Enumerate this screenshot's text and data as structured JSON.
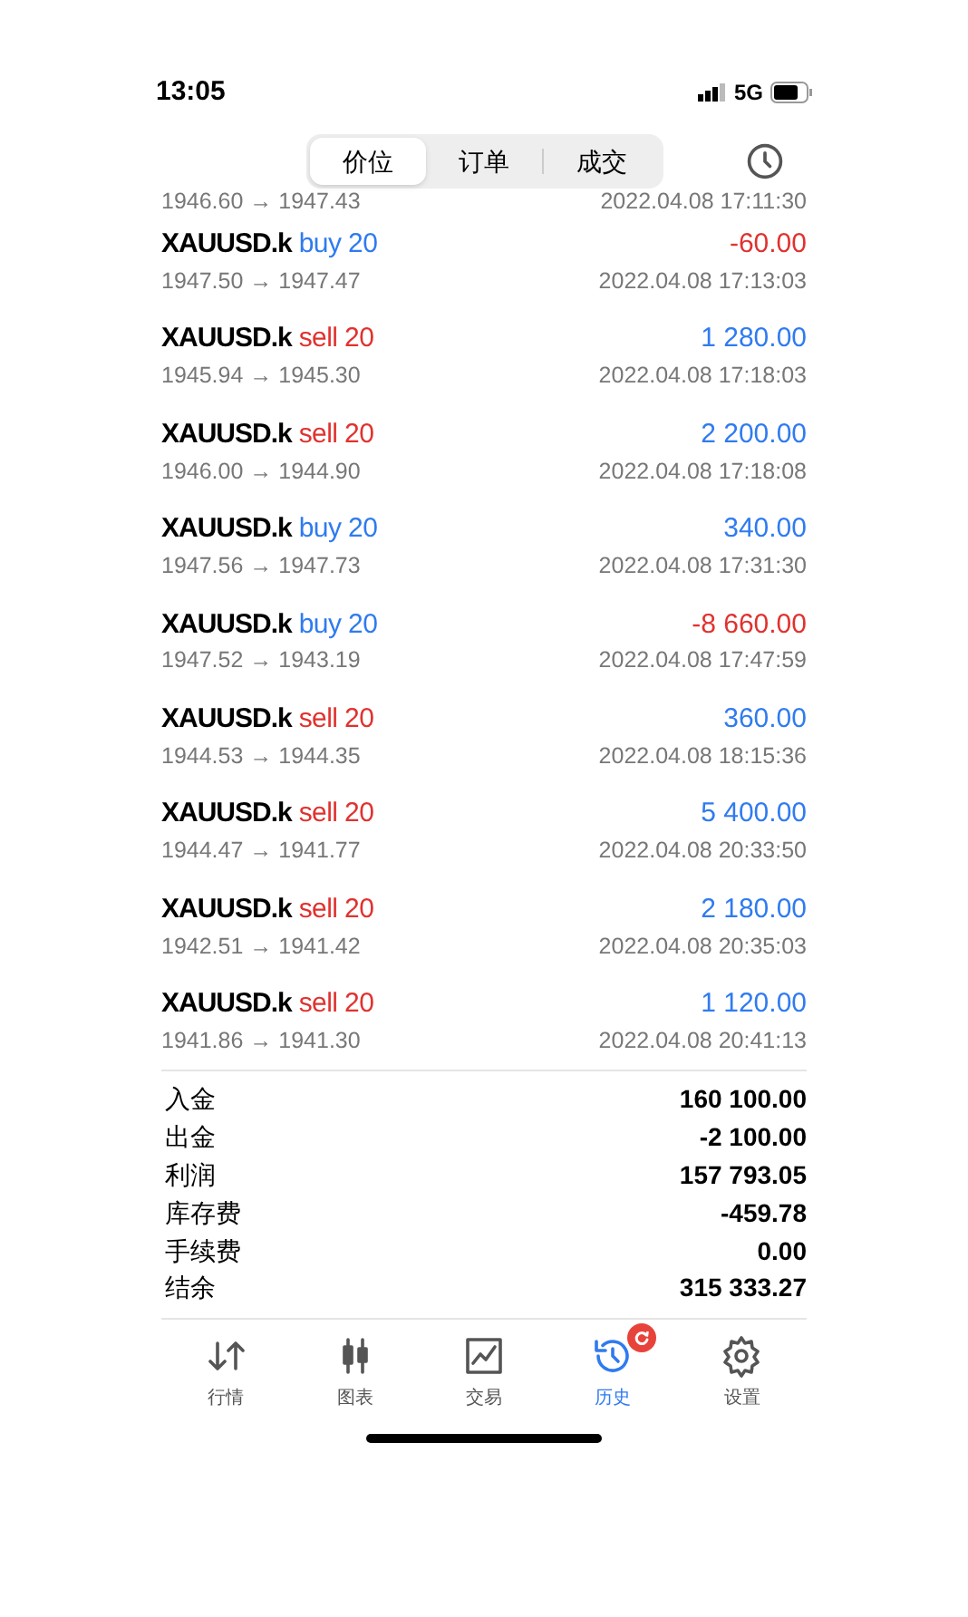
{
  "status_bar": {
    "time": "13:05",
    "network": "5G"
  },
  "tabs": [
    {
      "label": "价位",
      "selected": true
    },
    {
      "label": "订单",
      "selected": false
    },
    {
      "label": "成交",
      "selected": false
    }
  ],
  "partial_row": {
    "prices": "1946.60 → 1947.43",
    "time": "2022.04.08 17:11:30"
  },
  "deals": [
    {
      "symbol": "XAUUSD.k",
      "kind": "buy",
      "side": "buy",
      "volume": "20",
      "profit": "-60.00",
      "loss": true,
      "prices": "1947.50 → 1947.47",
      "time": "2022.04.08 17:13:03"
    },
    {
      "symbol": "XAUUSD.k",
      "kind": "sell",
      "side": "sell",
      "volume": "20",
      "profit": "1 280.00",
      "loss": false,
      "prices": "1945.94 → 1945.30",
      "time": "2022.04.08 17:18:03"
    },
    {
      "symbol": "XAUUSD.k",
      "kind": "sell",
      "side": "sell",
      "volume": "20",
      "profit": "2 200.00",
      "loss": false,
      "prices": "1946.00 → 1944.90",
      "time": "2022.04.08 17:18:08"
    },
    {
      "symbol": "XAUUSD.k",
      "kind": "buy",
      "side": "buy",
      "volume": "20",
      "profit": "340.00",
      "loss": false,
      "prices": "1947.56 → 1947.73",
      "time": "2022.04.08 17:31:30"
    },
    {
      "symbol": "XAUUSD.k",
      "kind": "buy",
      "side": "buy",
      "volume": "20",
      "profit": "-8 660.00",
      "loss": true,
      "prices": "1947.52 → 1943.19",
      "time": "2022.04.08 17:47:59"
    },
    {
      "symbol": "XAUUSD.k",
      "kind": "sell",
      "side": "sell",
      "volume": "20",
      "profit": "360.00",
      "loss": false,
      "prices": "1944.53 → 1944.35",
      "time": "2022.04.08 18:15:36"
    },
    {
      "symbol": "XAUUSD.k",
      "kind": "sell",
      "side": "sell",
      "volume": "20",
      "profit": "5 400.00",
      "loss": false,
      "prices": "1944.47 → 1941.77",
      "time": "2022.04.08 20:33:50"
    },
    {
      "symbol": "XAUUSD.k",
      "kind": "sell",
      "side": "sell",
      "volume": "20",
      "profit": "2 180.00",
      "loss": false,
      "prices": "1942.51 → 1941.42",
      "time": "2022.04.08 20:35:03"
    },
    {
      "symbol": "XAUUSD.k",
      "kind": "sell",
      "side": "sell",
      "volume": "20",
      "profit": "1 120.00",
      "loss": false,
      "prices": "1941.86 → 1941.30",
      "time": "2022.04.08 20:41:13"
    }
  ],
  "summary": [
    {
      "label": "入金",
      "value": "160 100.00"
    },
    {
      "label": "出金",
      "value": "-2 100.00"
    },
    {
      "label": "利润",
      "value": "157 793.05"
    },
    {
      "label": "库存费",
      "value": "-459.78"
    },
    {
      "label": "手续费",
      "value": "0.00"
    },
    {
      "label": "结余",
      "value": "315 333.27"
    }
  ],
  "nav": [
    {
      "kind": "quotes",
      "label": "行情",
      "selected": false,
      "badge": false
    },
    {
      "kind": "chart",
      "label": "图表",
      "selected": false,
      "badge": false
    },
    {
      "kind": "trade",
      "label": "交易",
      "selected": false,
      "badge": false
    },
    {
      "kind": "history",
      "label": "历史",
      "selected": true,
      "badge": true
    },
    {
      "kind": "settings",
      "label": "设置",
      "selected": false,
      "badge": false
    }
  ]
}
